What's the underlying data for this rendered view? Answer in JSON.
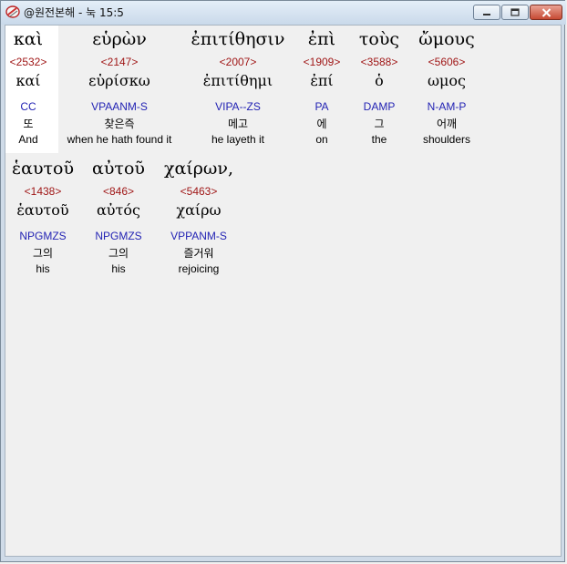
{
  "window": {
    "title": "@원전본해 - 눅 15:5"
  },
  "colors": {
    "strongs_number": "#a01818",
    "parsing_code": "#2323b4",
    "text": "#000000",
    "selected_background": "#ffffff"
  },
  "rows": [
    {
      "words": [
        {
          "greek": "καὶ",
          "strongs": "<2532>",
          "lemma": "καί",
          "parse": "CC",
          "korean": "또",
          "english": "And"
        },
        {
          "greek": "εὑρὼν",
          "strongs": "<2147>",
          "lemma": "εὑρίσκω",
          "parse": "VPAANM-S",
          "korean": "찾은즉",
          "english": "when he hath found it"
        },
        {
          "greek": "ἐπιτίθησιν",
          "strongs": "<2007>",
          "lemma": "ἐπιτίθημι",
          "parse": "VIPA--ZS",
          "korean": "메고",
          "english": "he layeth it"
        },
        {
          "greek": "ἐπὶ",
          "strongs": "<1909>",
          "lemma": "ἐπί",
          "parse": "PA",
          "korean": "에",
          "english": "on"
        },
        {
          "greek": "τοὺς",
          "strongs": "<3588>",
          "lemma": "ὁ",
          "parse": "DAMP",
          "korean": "그",
          "english": "the"
        },
        {
          "greek": "ὤμους",
          "strongs": "<5606>",
          "lemma": "ωμος",
          "parse": "N-AM-P",
          "korean": "어깨",
          "english": "shoulders"
        }
      ]
    },
    {
      "words": [
        {
          "greek": "ἑαυτοῦ",
          "strongs": "<1438>",
          "lemma": "ἑαυτοῦ",
          "parse": "NPGMZS",
          "korean": "그의",
          "english": "his"
        },
        {
          "greek": "αὐτοῦ",
          "strongs": "<846>",
          "lemma": "αὐτός",
          "parse": "NPGMZS",
          "korean": "그의",
          "english": "his"
        },
        {
          "greek": "χαίρων,",
          "strongs": "<5463>",
          "lemma": "χαίρω",
          "parse": "VPPANM-S",
          "korean": "즐거워",
          "english": "rejoicing"
        }
      ]
    }
  ]
}
